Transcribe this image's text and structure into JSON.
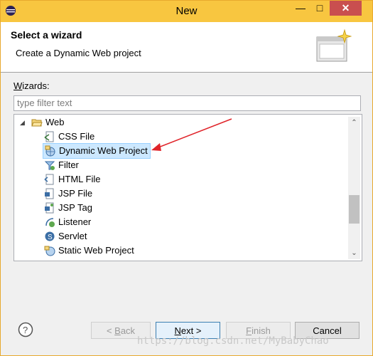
{
  "window": {
    "title": "New"
  },
  "header": {
    "title": "Select a wizard",
    "description": "Create a Dynamic Web project"
  },
  "wizards": {
    "label_prefix": "W",
    "label_rest": "izards:",
    "filter_placeholder": "type filter text"
  },
  "tree": {
    "folder": {
      "label": "Web",
      "expanded": true
    },
    "items": [
      {
        "label": "CSS File",
        "icon": "css-file-icon"
      },
      {
        "label": "Dynamic Web Project",
        "icon": "dynamic-web-project-icon",
        "selected": true
      },
      {
        "label": "Filter",
        "icon": "filter-icon"
      },
      {
        "label": "HTML File",
        "icon": "html-file-icon"
      },
      {
        "label": "JSP File",
        "icon": "jsp-file-icon"
      },
      {
        "label": "JSP Tag",
        "icon": "jsp-tag-icon"
      },
      {
        "label": "Listener",
        "icon": "listener-icon"
      },
      {
        "label": "Servlet",
        "icon": "servlet-icon"
      },
      {
        "label": "Static Web Project",
        "icon": "static-web-project-icon"
      }
    ]
  },
  "buttons": {
    "back": {
      "label_prefix": "< ",
      "mnemonic": "B",
      "label_rest": "ack",
      "enabled": false
    },
    "next": {
      "mnemonic": "N",
      "label_rest": "ext >",
      "enabled": true
    },
    "finish": {
      "mnemonic": "F",
      "label_rest": "inish",
      "enabled": false
    },
    "cancel": {
      "label": "Cancel",
      "enabled": true
    }
  },
  "watermark": "https://blog.csdn.net/MyBabyChao",
  "colors": {
    "titlebar": "#f8c640",
    "close": "#c94f4f",
    "selection": "#cce8ff",
    "annotation_arrow": "#e0242a"
  }
}
